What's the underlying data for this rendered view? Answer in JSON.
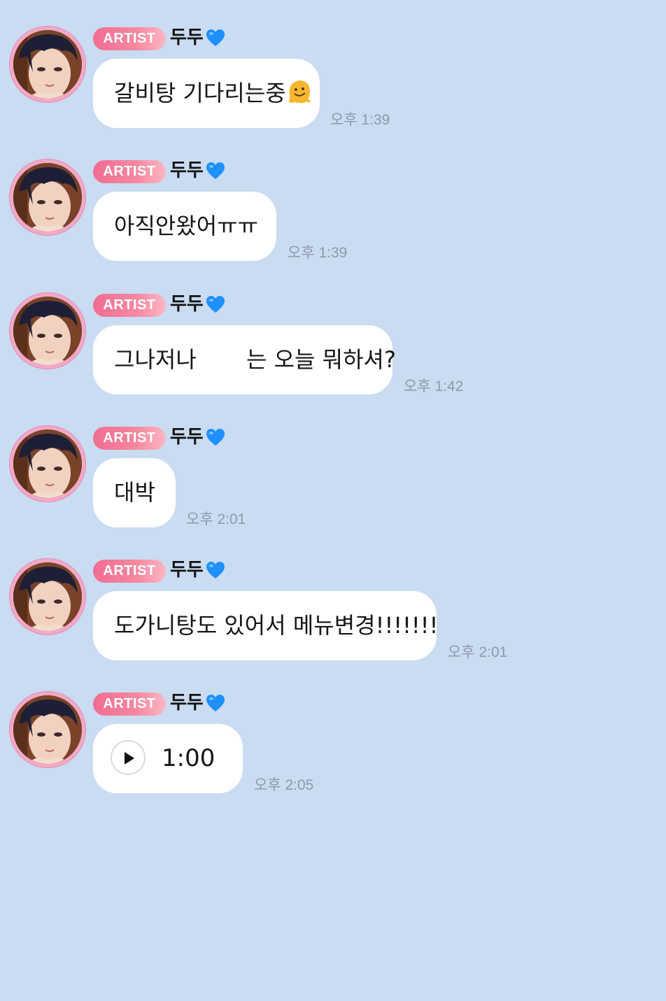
{
  "badge_label": "ARTIST",
  "sender_name": "두두",
  "icons": {
    "heart": "blue-heart-icon",
    "emoji": "melting-face-emoji-icon",
    "play": "play-icon"
  },
  "colors": {
    "background": "#c9dcf1",
    "badge": "#f06d92",
    "heart": "#1e90ff",
    "bubble": "#ffffff",
    "timestamp": "#8f9aa8"
  },
  "messages": [
    {
      "type": "text",
      "text": "갈비탕 기다리는중",
      "has_emoji": true,
      "time": "오후 1:39"
    },
    {
      "type": "text",
      "text": "아직안왔어ㅠㅠ",
      "has_emoji": false,
      "time": "오후 1:39"
    },
    {
      "type": "text",
      "text": "그나저나       는 오늘 뭐하셔?",
      "has_emoji": false,
      "time": "오후 1:42"
    },
    {
      "type": "text",
      "text": "대박",
      "has_emoji": false,
      "time": "오후 2:01"
    },
    {
      "type": "text",
      "text": "도가니탕도 있어서 메뉴변경!!!!!!!",
      "has_emoji": false,
      "time": "오후 2:01"
    },
    {
      "type": "voice",
      "duration": "1:00",
      "time": "오후 2:05"
    }
  ]
}
